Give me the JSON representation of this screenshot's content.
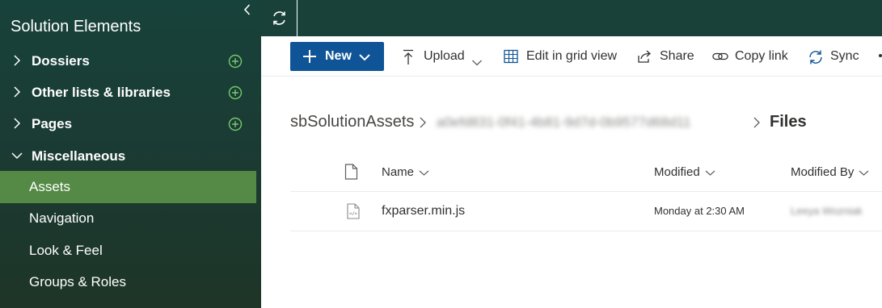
{
  "sidebar": {
    "title": "Solution Elements",
    "groups": [
      {
        "label": "Dossiers",
        "has_add": true
      },
      {
        "label": "Other lists & libraries",
        "has_add": true
      },
      {
        "label": "Pages",
        "has_add": true
      },
      {
        "label": "Miscellaneous",
        "has_add": false,
        "expanded": true
      }
    ],
    "items": [
      {
        "label": "Assets",
        "active": true
      },
      {
        "label": "Navigation",
        "active": false
      },
      {
        "label": "Look & Feel",
        "active": false
      },
      {
        "label": "Groups & Roles",
        "active": false
      }
    ]
  },
  "toolbar": {
    "new_label": "New",
    "upload_label": "Upload",
    "grid_label": "Edit in grid view",
    "share_label": "Share",
    "copy_link_label": "Copy link",
    "sync_label": "Sync"
  },
  "breadcrumb": {
    "root": "sbSolutionAssets",
    "middle_redacted": "a0efd831-0f41-4b81-9d7d-0b9577d68d11",
    "current": "Files"
  },
  "list": {
    "columns": {
      "name": "Name",
      "modified": "Modified",
      "modified_by": "Modified By"
    },
    "rows": [
      {
        "name": "fxparser.min.js",
        "modified": "Monday at 2:30 AM",
        "modified_by_redacted": "Leeya Wozniak"
      }
    ]
  },
  "colors": {
    "sidebar_bg": "#1b3a32",
    "active_item": "#548a46",
    "add_icon": "#7bc86c",
    "primary_button": "#0e5496",
    "topbar": "#1a4139"
  },
  "icons": {
    "collapse": "chevron-left-icon",
    "refresh": "refresh-icon",
    "new": "plus-icon",
    "upload": "upload-icon",
    "grid": "grid-icon",
    "share": "share-icon",
    "copy_link": "link-icon",
    "sync": "sync-icon",
    "file": "js-file-icon"
  }
}
